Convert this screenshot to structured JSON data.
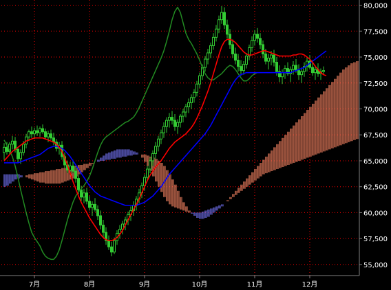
{
  "chart_data": {
    "type": "candlestick-ichimoku",
    "title": "",
    "ylim": [
      54000,
      80500
    ],
    "y_ticks": [
      "80,000",
      "77,500",
      "75,000",
      "72,500",
      "70,000",
      "67,500",
      "65,000",
      "62,500",
      "60,000",
      "57,500",
      "55,000"
    ],
    "y_tick_values": [
      80000,
      77500,
      75000,
      72500,
      70000,
      67500,
      65000,
      62500,
      60000,
      57500,
      55000
    ],
    "x_labels": [
      "7月",
      "8月",
      "9月",
      "10月",
      "11月",
      "12月"
    ],
    "x_label_index": [
      10,
      30,
      50,
      70,
      90,
      110
    ],
    "num_bars": 118,
    "num_cloud": 130,
    "colors": {
      "background": "#000000",
      "grid": "#ff0000",
      "axis": "#808080",
      "candle": "#33cc33",
      "tenkan": "#ff0000",
      "kijun": "#0000ff",
      "chikou": "#228b22",
      "cloud_bull": "#ff8866",
      "cloud_bear": "#7777ff"
    },
    "candles": [
      [
        65800,
        66700,
        65100,
        66300
      ],
      [
        66300,
        66800,
        65600,
        65900
      ],
      [
        65900,
        66800,
        65600,
        66600
      ],
      [
        66600,
        67400,
        66100,
        66900
      ],
      [
        66900,
        67300,
        65800,
        66100
      ],
      [
        66100,
        66300,
        64800,
        65200
      ],
      [
        65200,
        66100,
        64700,
        65800
      ],
      [
        65800,
        66900,
        65500,
        66600
      ],
      [
        66600,
        67600,
        66200,
        67300
      ],
      [
        67300,
        68000,
        66900,
        67800
      ],
      [
        67800,
        68300,
        67200,
        67600
      ],
      [
        67600,
        68200,
        67100,
        67900
      ],
      [
        67900,
        68400,
        67400,
        67700
      ],
      [
        67700,
        68300,
        67300,
        68100
      ],
      [
        68100,
        68500,
        67600,
        67800
      ],
      [
        67800,
        68100,
        67100,
        67300
      ],
      [
        67300,
        67900,
        66800,
        67600
      ],
      [
        67600,
        68000,
        67000,
        67200
      ],
      [
        67200,
        67700,
        66500,
        66800
      ],
      [
        66800,
        67100,
        65900,
        66200
      ],
      [
        66200,
        66800,
        65600,
        66500
      ],
      [
        66500,
        66900,
        65100,
        65400
      ],
      [
        65400,
        65800,
        64300,
        64600
      ],
      [
        64600,
        65000,
        63800,
        64100
      ],
      [
        64100,
        64900,
        63700,
        64500
      ],
      [
        64500,
        65100,
        63800,
        64000
      ],
      [
        64000,
        64400,
        62900,
        63300
      ],
      [
        63300,
        63700,
        61800,
        62200
      ],
      [
        62200,
        62600,
        61100,
        61500
      ],
      [
        61500,
        62300,
        60900,
        61900
      ],
      [
        61900,
        62400,
        60800,
        61100
      ],
      [
        61100,
        61600,
        60200,
        60500
      ],
      [
        60500,
        61100,
        59700,
        60800
      ],
      [
        60800,
        61400,
        60100,
        60300
      ],
      [
        60300,
        60700,
        59300,
        59700
      ],
      [
        59700,
        60200,
        58400,
        58800
      ],
      [
        58800,
        59300,
        57600,
        58100
      ],
      [
        58100,
        58600,
        56900,
        57300
      ],
      [
        57300,
        57800,
        56400,
        56700
      ],
      [
        56700,
        57200,
        55800,
        56200
      ],
      [
        56200,
        57600,
        56000,
        57300
      ],
      [
        57300,
        58300,
        56900,
        58000
      ],
      [
        58000,
        58800,
        57500,
        58400
      ],
      [
        58400,
        59200,
        57900,
        58900
      ],
      [
        58900,
        59600,
        58300,
        59300
      ],
      [
        59300,
        60100,
        58800,
        59800
      ],
      [
        59800,
        60600,
        59200,
        60200
      ],
      [
        60200,
        61100,
        59700,
        60700
      ],
      [
        60700,
        61600,
        60200,
        61300
      ],
      [
        61300,
        62300,
        60900,
        61900
      ],
      [
        61900,
        62900,
        61400,
        62600
      ],
      [
        62600,
        63700,
        62100,
        63400
      ],
      [
        63400,
        64500,
        63000,
        64200
      ],
      [
        64200,
        65300,
        63800,
        65000
      ],
      [
        65000,
        66000,
        64500,
        65700
      ],
      [
        65700,
        66800,
        65200,
        66400
      ],
      [
        66400,
        67400,
        65900,
        67100
      ],
      [
        67100,
        68000,
        66600,
        67700
      ],
      [
        67700,
        68700,
        67200,
        68300
      ],
      [
        68300,
        69200,
        67700,
        68900
      ],
      [
        68900,
        69600,
        68200,
        69200
      ],
      [
        69200,
        69800,
        68500,
        68900
      ],
      [
        68900,
        69500,
        67900,
        68300
      ],
      [
        68300,
        69000,
        67600,
        68700
      ],
      [
        68700,
        69500,
        68200,
        69300
      ],
      [
        69300,
        70000,
        68700,
        69700
      ],
      [
        69700,
        70500,
        69200,
        70200
      ],
      [
        70200,
        71000,
        69600,
        70600
      ],
      [
        70600,
        71400,
        70000,
        71100
      ],
      [
        71100,
        71900,
        70600,
        71600
      ],
      [
        71600,
        72700,
        71200,
        72400
      ],
      [
        72400,
        73500,
        72000,
        73200
      ],
      [
        73200,
        74300,
        72800,
        74000
      ],
      [
        74000,
        75100,
        73600,
        74800
      ],
      [
        74800,
        75800,
        74300,
        75400
      ],
      [
        75400,
        76400,
        74900,
        76100
      ],
      [
        76100,
        77300,
        75700,
        76900
      ],
      [
        76900,
        78100,
        76500,
        77700
      ],
      [
        77700,
        79000,
        77300,
        78600
      ],
      [
        78600,
        79900,
        78200,
        79300
      ],
      [
        79300,
        79800,
        77700,
        78100
      ],
      [
        78100,
        78600,
        76800,
        77200
      ],
      [
        77200,
        77700,
        75800,
        76200
      ],
      [
        76200,
        76700,
        74900,
        75300
      ],
      [
        75300,
        75900,
        74300,
        74700
      ],
      [
        74700,
        75300,
        73600,
        74100
      ],
      [
        74100,
        74700,
        73200,
        73700
      ],
      [
        73700,
        74600,
        73300,
        74300
      ],
      [
        74300,
        75400,
        73900,
        75100
      ],
      [
        75100,
        76200,
        74700,
        75900
      ],
      [
        75900,
        77000,
        75500,
        76600
      ],
      [
        76600,
        77600,
        76100,
        77200
      ],
      [
        77200,
        77800,
        76400,
        76800
      ],
      [
        76800,
        77300,
        75800,
        76200
      ],
      [
        76200,
        76600,
        74900,
        75300
      ],
      [
        75300,
        75800,
        74300,
        74600
      ],
      [
        74600,
        75300,
        73800,
        74900
      ],
      [
        74900,
        75600,
        74200,
        75200
      ],
      [
        75200,
        75700,
        74100,
        74500
      ],
      [
        74500,
        75000,
        73200,
        73600
      ],
      [
        73600,
        74200,
        72600,
        73100
      ],
      [
        73100,
        73800,
        72400,
        73500
      ],
      [
        73500,
        74200,
        72900,
        73900
      ],
      [
        73900,
        74500,
        73200,
        73400
      ],
      [
        73400,
        74100,
        72600,
        73800
      ],
      [
        73800,
        74600,
        73300,
        74200
      ],
      [
        74200,
        74800,
        73500,
        73700
      ],
      [
        73700,
        74300,
        72800,
        73300
      ],
      [
        73300,
        74000,
        72500,
        73600
      ],
      [
        73600,
        74500,
        73100,
        74100
      ],
      [
        74100,
        75000,
        73600,
        74600
      ],
      [
        74600,
        75200,
        73800,
        74000
      ],
      [
        74000,
        74700,
        73200,
        73500
      ],
      [
        73500,
        74200,
        72800,
        73800
      ],
      [
        73800,
        74400,
        73100,
        73400
      ],
      [
        73400,
        73900,
        72800,
        73600
      ],
      [
        73600,
        74100,
        73300,
        73700
      ]
    ],
    "tenkan": [
      65000,
      65300,
      65600,
      65900,
      66100,
      66300,
      66500,
      66700,
      66900,
      67000,
      67100,
      67200,
      67200,
      67200,
      67200,
      67100,
      67000,
      66900,
      66800,
      66600,
      66300,
      65900,
      65300,
      64600,
      63800,
      63000,
      62300,
      61600,
      61000,
      60500,
      60000,
      59500,
      59100,
      58700,
      58300,
      57900,
      57600,
      57400,
      57300,
      57300,
      57400,
      57600,
      57900,
      58300,
      58800,
      59300,
      59800,
      60300,
      60800,
      61300,
      61900,
      62500,
      63100,
      63600,
      64000,
      64400,
      64700,
      65000,
      65400,
      65800,
      66200,
      66500,
      66800,
      67000,
      67200,
      67400,
      67600,
      67900,
      68200,
      68600,
      69100,
      69700,
      70300,
      71000,
      71700,
      72500,
      73400,
      74300,
      75200,
      76000,
      76500,
      76700,
      76700,
      76600,
      76400,
      76100,
      75800,
      75500,
      75300,
      75200,
      75200,
      75300,
      75400,
      75500,
      75600,
      75600,
      75500,
      75400,
      75300,
      75200,
      75100,
      75100,
      75100,
      75100,
      75100,
      75200,
      75200,
      75300,
      75300,
      75200,
      75000,
      74800,
      74500,
      74100,
      73800,
      73500,
      73300,
      73200
    ],
    "kijun": [
      64800,
      64800,
      64800,
      64800,
      64800,
      64800,
      64900,
      65000,
      65100,
      65200,
      65300,
      65400,
      65500,
      65600,
      65800,
      66000,
      66200,
      66300,
      66400,
      66400,
      66300,
      66200,
      66000,
      65700,
      65400,
      65000,
      64600,
      64200,
      63800,
      63400,
      63000,
      62600,
      62300,
      62000,
      61800,
      61600,
      61500,
      61400,
      61300,
      61200,
      61100,
      61000,
      60900,
      60800,
      60700,
      60700,
      60700,
      60700,
      60700,
      60800,
      60900,
      61000,
      61200,
      61400,
      61600,
      61900,
      62200,
      62500,
      62900,
      63300,
      63700,
      64000,
      64300,
      64600,
      64900,
      65200,
      65500,
      65800,
      66100,
      66400,
      66700,
      67000,
      67300,
      67600,
      68000,
      68400,
      68900,
      69400,
      69900,
      70400,
      70900,
      71400,
      71900,
      72400,
      72800,
      73100,
      73300,
      73400,
      73500,
      73500,
      73500,
      73500,
      73500,
      73500,
      73500,
      73500,
      73500,
      73500,
      73500,
      73500,
      73500,
      73500,
      73500,
      73500,
      73500,
      73600,
      73700,
      73800,
      73900,
      74000,
      74200,
      74400,
      74600,
      74800,
      75000,
      75200,
      75400,
      75600
    ],
    "chikou": [
      67000,
      66500,
      66000,
      65400,
      64500,
      63400,
      62200,
      61100,
      60000,
      59000,
      58100,
      57600,
      57200,
      56800,
      56200,
      55800,
      55600,
      55500,
      55500,
      55800,
      56400,
      57300,
      58300,
      59300,
      60200,
      61000,
      61600,
      62000,
      62300,
      62600,
      63000,
      63500,
      64200,
      65000,
      65800,
      66500,
      67000,
      67300,
      67500,
      67700,
      67900,
      68100,
      68300,
      68500,
      68700,
      68800,
      69000,
      69200,
      69600,
      70100,
      70700,
      71300,
      71900,
      72500,
      73100,
      73700,
      74300,
      74900,
      75600,
      76500,
      77500,
      78600,
      79400,
      79800,
      79300,
      78300,
      77300,
      76700,
      76300,
      75800,
      75300,
      74700,
      74000,
      73400,
      73000,
      72800,
      72800,
      73000,
      73200,
      73400,
      73700,
      74000,
      74200,
      74100,
      73800,
      73400,
      73000,
      72700,
      72700,
      72900,
      73200,
      73400,
      73500
    ],
    "senkou_a": [
      62500,
      62600,
      62800,
      63000,
      63200,
      63300,
      63400,
      63500,
      63600,
      63700,
      63700,
      63800,
      63800,
      63900,
      63900,
      64000,
      64000,
      64100,
      64100,
      64200,
      64200,
      64300,
      64300,
      64400,
      64400,
      64500,
      64500,
      64600,
      64600,
      64700,
      64700,
      64800,
      64800,
      64900,
      64900,
      65000,
      65000,
      65100,
      65100,
      65200,
      65200,
      65300,
      65300,
      65400,
      65400,
      65500,
      65500,
      65600,
      65600,
      65600,
      65600,
      65600,
      65500,
      65400,
      65300,
      65200,
      65000,
      64800,
      64500,
      64100,
      63700,
      63200,
      62700,
      62100,
      61500,
      61000,
      60600,
      60200,
      59900,
      59700,
      59500,
      59400,
      59400,
      59500,
      59600,
      59800,
      60000,
      60200,
      60400,
      60600,
      60900,
      61200,
      61500,
      61800,
      62100,
      62400,
      62700,
      63000,
      63300,
      63600,
      63900,
      64200,
      64500,
      64800,
      65100,
      65400,
      65700,
      66000,
      66300,
      66600,
      66900,
      67200,
      67500,
      67800,
      68100,
      68400,
      68700,
      69000,
      69300,
      69600,
      69900,
      70200,
      70500,
      70800,
      71100,
      71400,
      71700,
      72000,
      72300,
      72600,
      72900,
      73200,
      73500,
      73800,
      74000,
      74200,
      74400,
      74500,
      74600,
      74700
    ],
    "senkou_b": [
      63700,
      63700,
      63700,
      63700,
      63700,
      63700,
      63600,
      63500,
      63400,
      63300,
      63200,
      63100,
      63000,
      62900,
      62900,
      62800,
      62800,
      62800,
      62800,
      62800,
      62800,
      62900,
      63000,
      63100,
      63200,
      63300,
      63500,
      63700,
      63900,
      64100,
      64300,
      64500,
      64700,
      64900,
      65100,
      65300,
      65500,
      65700,
      65800,
      65900,
      66000,
      66100,
      66100,
      66100,
      66100,
      66100,
      66000,
      65900,
      65800,
      65600,
      65300,
      64900,
      64500,
      64000,
      63500,
      63000,
      62500,
      62000,
      61500,
      61100,
      60800,
      60600,
      60500,
      60400,
      60300,
      60200,
      60100,
      60000,
      60000,
      60000,
      60000,
      60000,
      60100,
      60200,
      60300,
      60400,
      60500,
      60600,
      60700,
      60800,
      60900,
      61100,
      61300,
      61500,
      61700,
      61900,
      62100,
      62300,
      62500,
      62700,
      62900,
      63100,
      63300,
      63500,
      63700,
      63800,
      63900,
      64000,
      64100,
      64200,
      64300,
      64400,
      64500,
      64600,
      64700,
      64800,
      64900,
      65000,
      65100,
      65200,
      65300,
      65400,
      65500,
      65600,
      65700,
      65800,
      65900,
      66000,
      66100,
      66200,
      66300,
      66400,
      66500,
      66600,
      66700,
      66800,
      66900,
      67000,
      67100,
      67200
    ]
  }
}
